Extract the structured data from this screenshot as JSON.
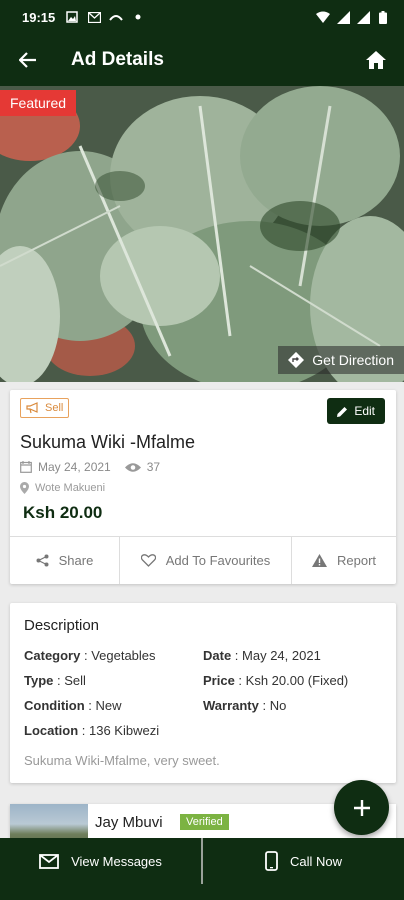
{
  "status_bar": {
    "time": "19:15"
  },
  "app_bar": {
    "title": "Ad Details"
  },
  "hero": {
    "featured_label": "Featured",
    "direction_label": "Get Direction"
  },
  "ad": {
    "type_badge": "Sell",
    "edit_label": "Edit",
    "title": "Sukuma Wiki -Mfalme",
    "date": "May 24, 2021",
    "views": "37",
    "location": "Wote Makueni",
    "price": "Ksh 20.00"
  },
  "actions": {
    "share": "Share",
    "favourite": "Add To Favourites",
    "report": "Report"
  },
  "description": {
    "heading": "Description",
    "category_label": "Category",
    "category_value": " : Vegetables",
    "date_label": "Date",
    "date_value": " : May 24, 2021",
    "type_label": "Type",
    "type_value": " : Sell",
    "price_label": "Price",
    "price_value": " : Ksh 20.00 (Fixed)",
    "condition_label": "Condition",
    "condition_value": " : New",
    "warranty_label": "Warranty",
    "warranty_value": " : No",
    "location_label": "Location",
    "location_value": " : 136 Kibwezi",
    "text": "Sukuma Wiki-Mfalme, very sweet."
  },
  "seller": {
    "name": "Jay Mbuvi",
    "verified_label": "Verified"
  },
  "bottom": {
    "messages": "View Messages",
    "call": "Call Now"
  },
  "colors": {
    "primary": "#0f2d12",
    "featured": "#e53935",
    "verified": "#7cb342",
    "sell_badge": "#d98a3c"
  }
}
